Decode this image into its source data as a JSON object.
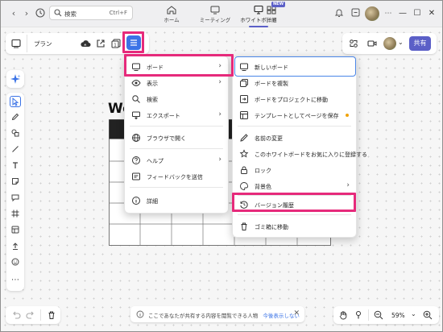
{
  "titlebar": {
    "search_placeholder": "検索",
    "search_shortcut": "Ctrl+F",
    "nav_tabs": [
      {
        "label": "ホーム",
        "icon": "home-icon"
      },
      {
        "label": "ミーティング",
        "icon": "meeting-icon"
      },
      {
        "label": "ホワイトボード",
        "icon": "whiteboard-icon",
        "active": true
      },
      {
        "label": "詳細",
        "icon": "more-apps-icon",
        "badge": "NEW"
      }
    ]
  },
  "board": {
    "name": "プラン",
    "share_label": "共有",
    "canvas_heading": "We"
  },
  "main_menu": {
    "items": [
      {
        "label": "ボード",
        "icon": "board-icon",
        "submenu": true
      },
      {
        "label": "表示",
        "icon": "eye-icon",
        "submenu": true
      },
      {
        "label": "検索",
        "icon": "search-icon"
      },
      {
        "label": "エクスポート",
        "icon": "export-icon",
        "submenu": true
      },
      {
        "label": "ブラウザで開く",
        "icon": "globe-icon"
      },
      {
        "label": "ヘルプ",
        "icon": "help-icon",
        "submenu": true
      },
      {
        "label": "フィードバックを送信",
        "icon": "feedback-icon"
      },
      {
        "label": "詳細",
        "icon": "info-icon"
      }
    ]
  },
  "board_submenu": {
    "items": [
      {
        "label": "新しいボード",
        "icon": "new-board-icon"
      },
      {
        "label": "ボードを複製",
        "icon": "duplicate-icon"
      },
      {
        "label": "ボードをプロジェクトに移動",
        "icon": "move-icon"
      },
      {
        "label": "テンプレートとしてページを保存",
        "icon": "template-icon"
      },
      {
        "label": "名前の変更",
        "icon": "rename-icon"
      },
      {
        "label": "このホワイトボードをお気に入りに登録する",
        "icon": "star-icon"
      },
      {
        "label": "ロック",
        "icon": "lock-icon"
      },
      {
        "label": "背景色",
        "icon": "palette-icon",
        "submenu": true
      },
      {
        "label": "バージョン履歴",
        "icon": "history-icon"
      },
      {
        "label": "ゴミ箱に移動",
        "icon": "trash-icon"
      }
    ]
  },
  "footer": {
    "hint_text": "ここであなたが共有する内容を閲覧できる人物",
    "hint_link": "今後表示しない",
    "zoom": "59%"
  },
  "colors": {
    "accent": "#5b5fc7",
    "menu_button": "#3b73e6",
    "highlight": "#e62a7b"
  }
}
